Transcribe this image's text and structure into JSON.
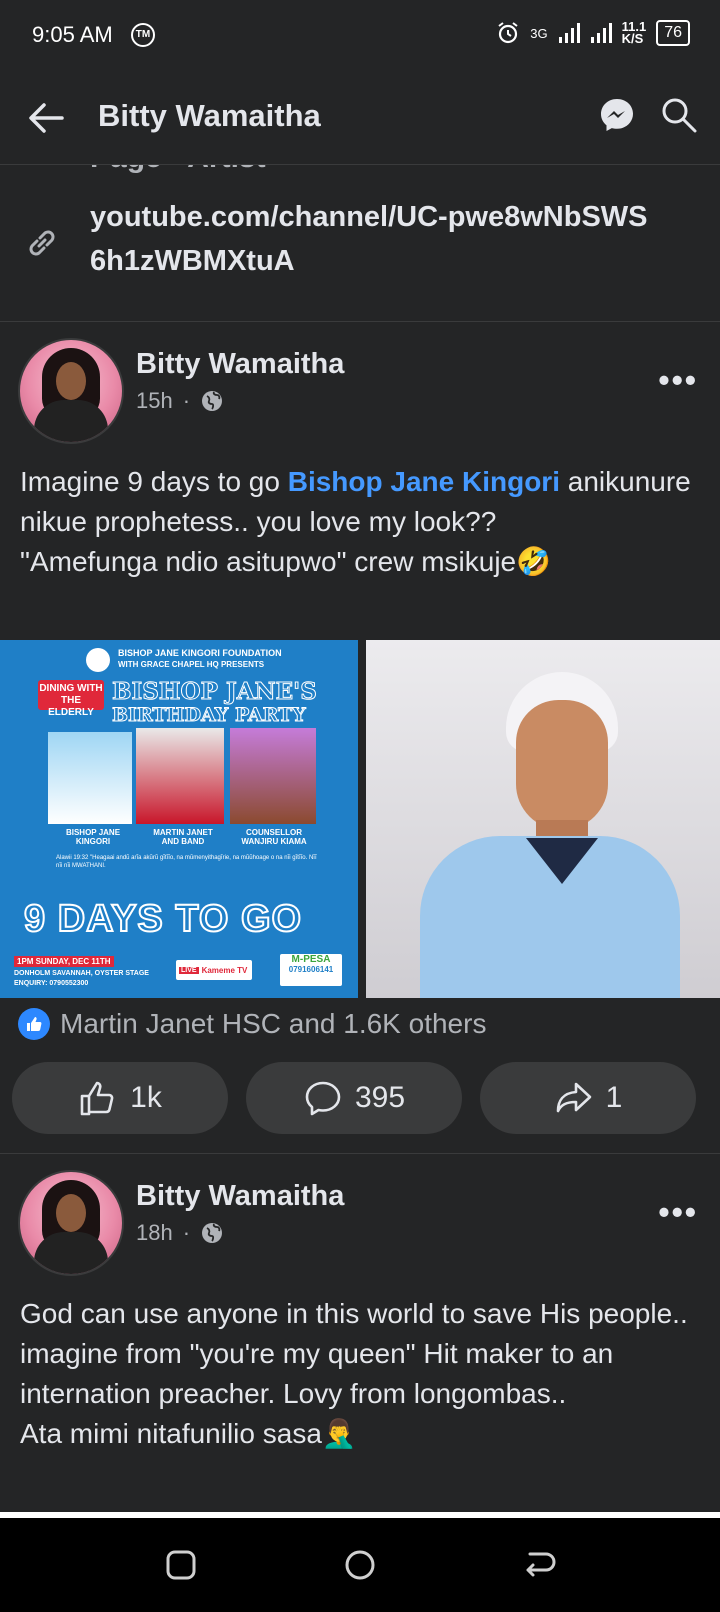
{
  "status_bar": {
    "time": "9:05 AM",
    "network": "3G",
    "speed": "11.1",
    "speed_unit": "K/S",
    "battery": "76"
  },
  "header": {
    "title": "Bitty Wamaitha"
  },
  "about": {
    "cut_text": "Page · Artist",
    "link": "youtube.com/channel/UC-pwe8wNbSWS6h1zWBMXtuA"
  },
  "posts": [
    {
      "author": "Bitty Wamaitha",
      "time": "15h",
      "text_before": "Imagine 9 days to go ",
      "mention": "Bishop Jane Kingori",
      "text_after": " anikunure nikue prophetess.. you love my look??",
      "text_line2": "\"Amefunga ndio asitupwo\" crew msikuje🤣",
      "reactions": "Martin Janet HSC and 1.6K others",
      "likes": "1k",
      "comments": "395",
      "shares": "1",
      "poster": {
        "foundation": "BISHOP JANE KINGORI FOUNDATION",
        "presents": "WITH GRACE CHAPEL HQ PRESENTS",
        "dining": "DINING WITH THE ELDERLY",
        "headline1": "BISHOP JANE'S",
        "headline2": "BIRTHDAY PARTY",
        "person1": "BISHOP JANE KINGORI",
        "person2": "MARTIN JANET AND BAND",
        "person3": "COUNSELLOR WANJIRU KIAMA",
        "verse": "Alawii 19:32 \"Heagaai andũ arĩa akũrũ gĩtĩĩo, na mũmenyithagĩrie, na mũũhoage o na nĩi gĩtĩĩo. Nĩĩ nĩi nĩi MWATHANI.",
        "countdown": "9 DAYS TO GO",
        "when": "1PM SUNDAY, DEC 11TH",
        "where": "DONHOLM SAVANNAH, OYSTER STAGE",
        "enquiry": "ENQUIRY: 0790552300",
        "live": "LIVE",
        "tv": "Kameme TV",
        "mpesa": "M-PESA",
        "mpesa_no": "0791606141"
      }
    },
    {
      "author": "Bitty Wamaitha",
      "time": "18h",
      "text": "God can use anyone in this world to save His people.. imagine from \"you're my queen\" Hit maker to an internation preacher. Lovy from longombas..",
      "text_line2": "Ata mimi nitafunilio sasa🤦‍♂️"
    }
  ],
  "colors": {
    "background": "#242526",
    "text": "#e4e6eb",
    "secondary": "#b0b3b8",
    "mention": "#4599ff",
    "button_bg": "#3a3b3c"
  }
}
